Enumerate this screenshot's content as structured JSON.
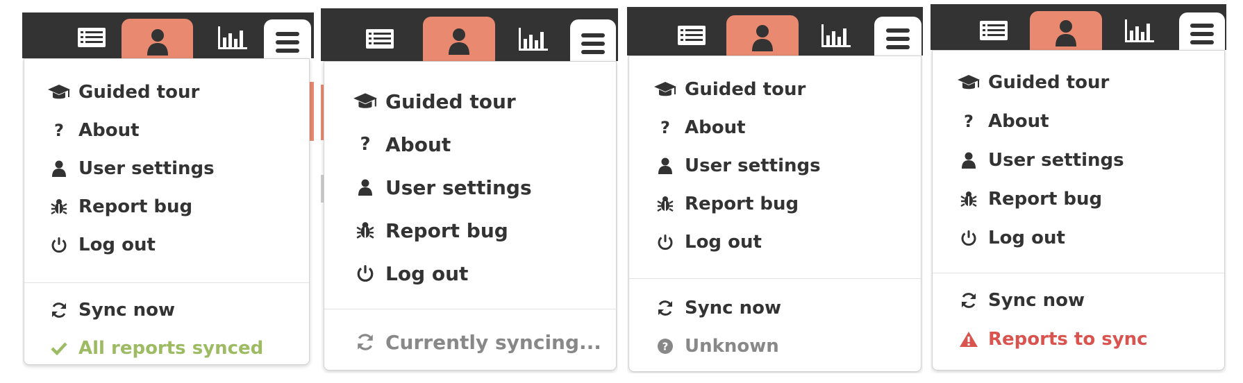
{
  "colors": {
    "header": "#333333",
    "accent": "#e98a70",
    "text": "#333333",
    "synced": "#9dbb63",
    "muted": "#888888",
    "error": "#d9534f"
  },
  "nav_tabs": [
    {
      "name": "reports",
      "icon": "list-icon"
    },
    {
      "name": "profile",
      "icon": "user-icon",
      "active": true
    },
    {
      "name": "analytics",
      "icon": "bar-chart-icon"
    },
    {
      "name": "menu",
      "icon": "hamburger-icon",
      "open": true
    }
  ],
  "menu_items": {
    "guided_tour": "Guided tour",
    "about": "About",
    "user_settings": "User settings",
    "report_bug": "Report bug",
    "log_out": "Log out",
    "sync_now": "Sync now"
  },
  "panels": [
    {
      "variant": "synced",
      "status_text": "All reports synced",
      "status_icon": "check-icon",
      "status_color": "#9dbb63"
    },
    {
      "variant": "syncing",
      "status_text": "Currently syncing...",
      "status_icon": "sync-icon",
      "status_color": "#888888"
    },
    {
      "variant": "unknown",
      "status_text": "Unknown",
      "status_icon": "question-circle-icon",
      "status_color": "#888888"
    },
    {
      "variant": "needs-sync",
      "status_text": "Reports to sync",
      "status_icon": "warning-icon",
      "status_color": "#d9534f"
    }
  ]
}
